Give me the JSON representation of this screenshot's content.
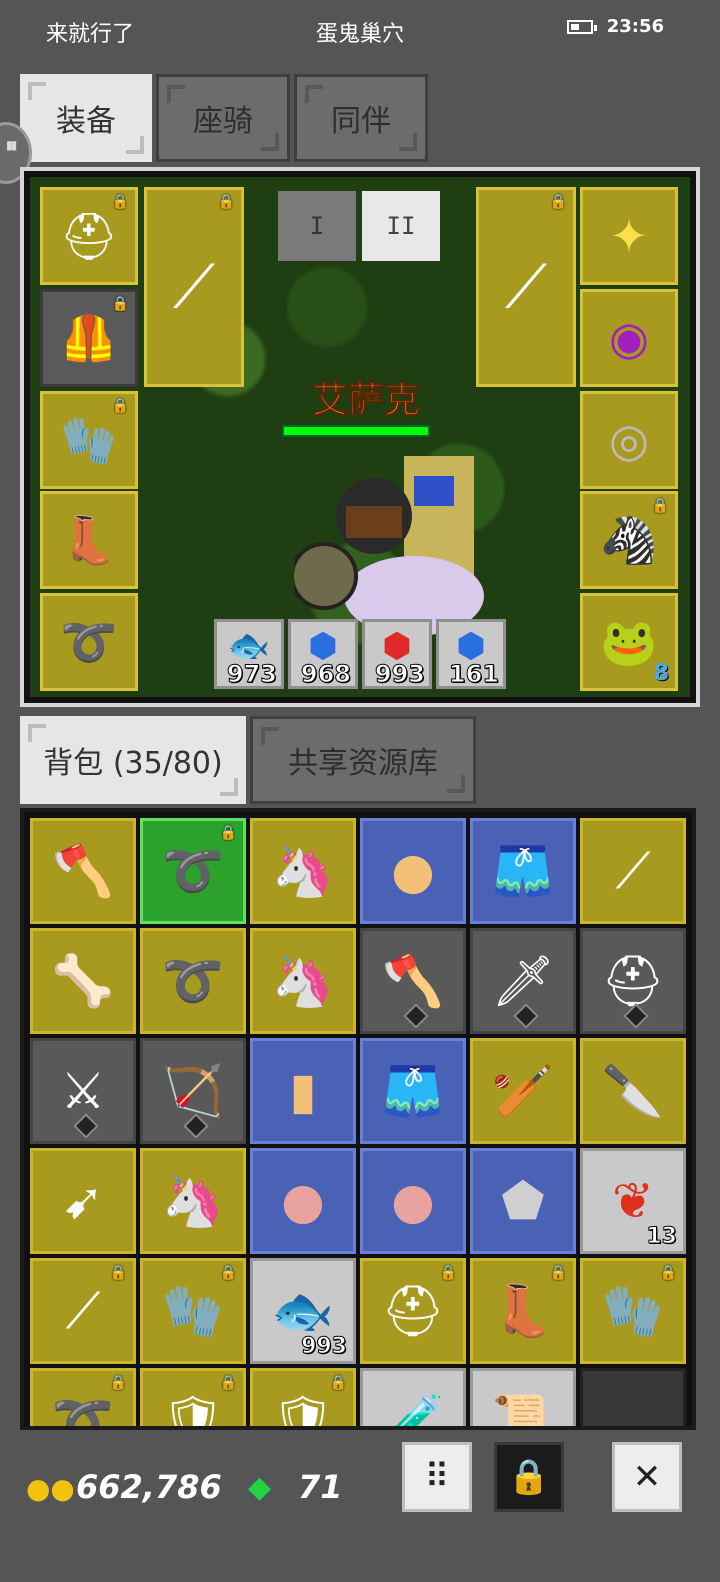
{
  "status_bar": {
    "left_text": "来就行了",
    "center_text": "蛋鬼巢穴",
    "time": "23:56"
  },
  "top_tabs": [
    {
      "label": "装备"
    },
    {
      "label": "座骑"
    },
    {
      "label": "同伴"
    }
  ],
  "equipment": {
    "mode_buttons": [
      {
        "label": "I"
      },
      {
        "label": "II"
      }
    ],
    "active_mode": "II",
    "character_name": "艾萨克",
    "left_slots": [
      "helmet-icon",
      "chest-armor-icon",
      "gauntlet-icon",
      "boots-icon",
      "belt-icon"
    ],
    "right_slots": [
      "amulet-icon",
      "ring-purple-icon",
      "ring-silver-icon",
      "pet-card-zebra-icon",
      "pet-card-frog-icon"
    ],
    "pet_level": "8",
    "potions": [
      {
        "icon": "fish-icon",
        "count": "973"
      },
      {
        "icon": "blue-potion-icon",
        "count": "968"
      },
      {
        "icon": "red-potion-icon",
        "count": "993"
      },
      {
        "icon": "blue-potion-icon",
        "count": "161"
      }
    ]
  },
  "bag_tabs": [
    {
      "label": "背包 (35/80)"
    },
    {
      "label": "共享资源库"
    }
  ],
  "bag": {
    "red_leaf_count": "13",
    "fish_count": "993"
  },
  "currency": {
    "gold": "662,786",
    "gems": "71"
  },
  "colors": {
    "rare_yellow": "#a89a1e",
    "magic_blue": "#4a62b6",
    "common_gray": "#595959",
    "selected_green": "#2ba22b",
    "name_orange": "#ff9a1a"
  }
}
